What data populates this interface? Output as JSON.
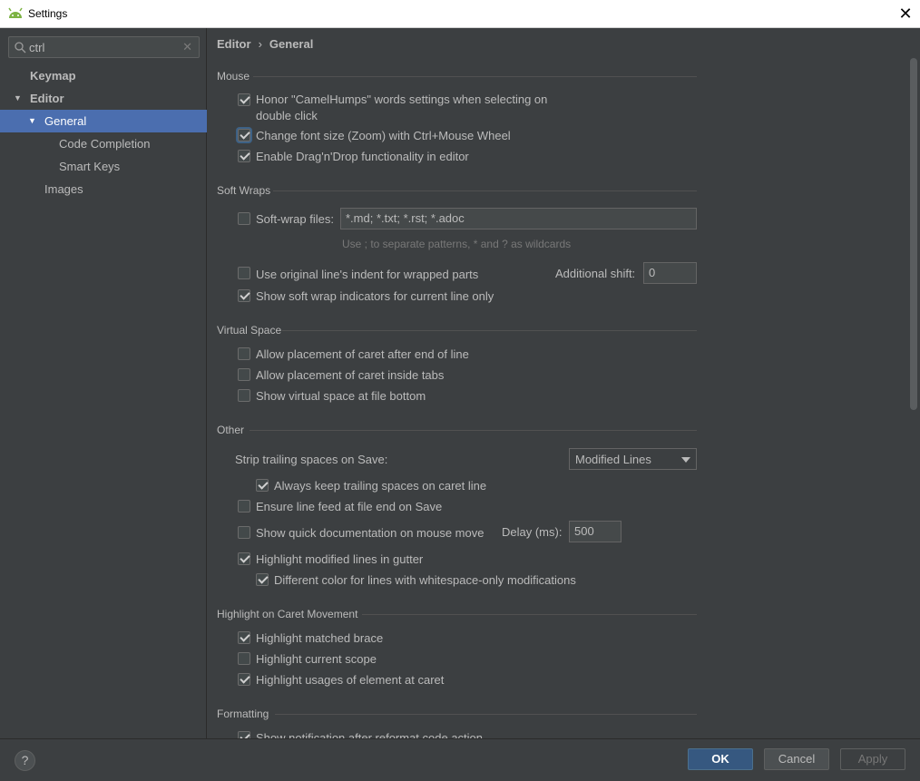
{
  "window": {
    "title": "Settings",
    "close_glyph": "✕"
  },
  "sidebar": {
    "search_value": "ctrl",
    "search_clear": "✕",
    "items": [
      {
        "label": "Keymap"
      },
      {
        "label": "Editor"
      },
      {
        "label": "General"
      },
      {
        "label": "Code Completion"
      },
      {
        "label": "Smart Keys"
      },
      {
        "label": "Images"
      }
    ]
  },
  "breadcrumb": {
    "parent": "Editor",
    "separator": "›",
    "current": "General"
  },
  "sections": {
    "mouse": {
      "title": "Mouse",
      "camelhumps_line1": "Honor \"CamelHumps\" words settings when selecting on",
      "camelhumps_line2": "double click",
      "zoom": "Change font size (Zoom) with Ctrl+Mouse Wheel",
      "dragdrop": "Enable Drag'n'Drop functionality in editor"
    },
    "soft_wraps": {
      "title": "Soft Wraps",
      "softwrap_files": "Soft-wrap files:",
      "softwrap_patterns": "*.md; *.txt; *.rst; *.adoc",
      "patterns_hint": "Use ; to separate patterns, * and ? as wildcards",
      "original_indent": "Use original line's indent for wrapped parts",
      "additional_shift_label": "Additional shift:",
      "additional_shift_value": "0",
      "indicators": "Show soft wrap indicators for current line only"
    },
    "virtual_space": {
      "title": "Virtual Space",
      "after_end": "Allow placement of caret after end of line",
      "inside_tabs": "Allow placement of caret inside tabs",
      "file_bottom": "Show virtual space at file bottom"
    },
    "other": {
      "title": "Other",
      "strip_label": "Strip trailing spaces on Save:",
      "strip_value": "Modified Lines",
      "keep_caret": "Always keep trailing spaces on caret line",
      "ensure_lf": "Ensure line feed at file end on Save",
      "quick_doc": "Show quick documentation on mouse move",
      "delay_label": "Delay (ms):",
      "delay_value": "500",
      "highlight_modified": "Highlight modified lines in gutter",
      "different_color": "Different color for lines with whitespace-only modifications"
    },
    "caret": {
      "title": "Highlight on Caret Movement",
      "matched_brace": "Highlight matched brace",
      "current_scope": "Highlight current scope",
      "usages": "Highlight usages of element at caret"
    },
    "formatting": {
      "title": "Formatting",
      "notification": "Show notification after reformat code action"
    }
  },
  "footer": {
    "help": "?",
    "ok": "OK",
    "cancel": "Cancel",
    "apply": "Apply"
  },
  "colors": {
    "accent": "#4b6eaf",
    "primary_button": "#365880",
    "background": "#3c3f41"
  }
}
